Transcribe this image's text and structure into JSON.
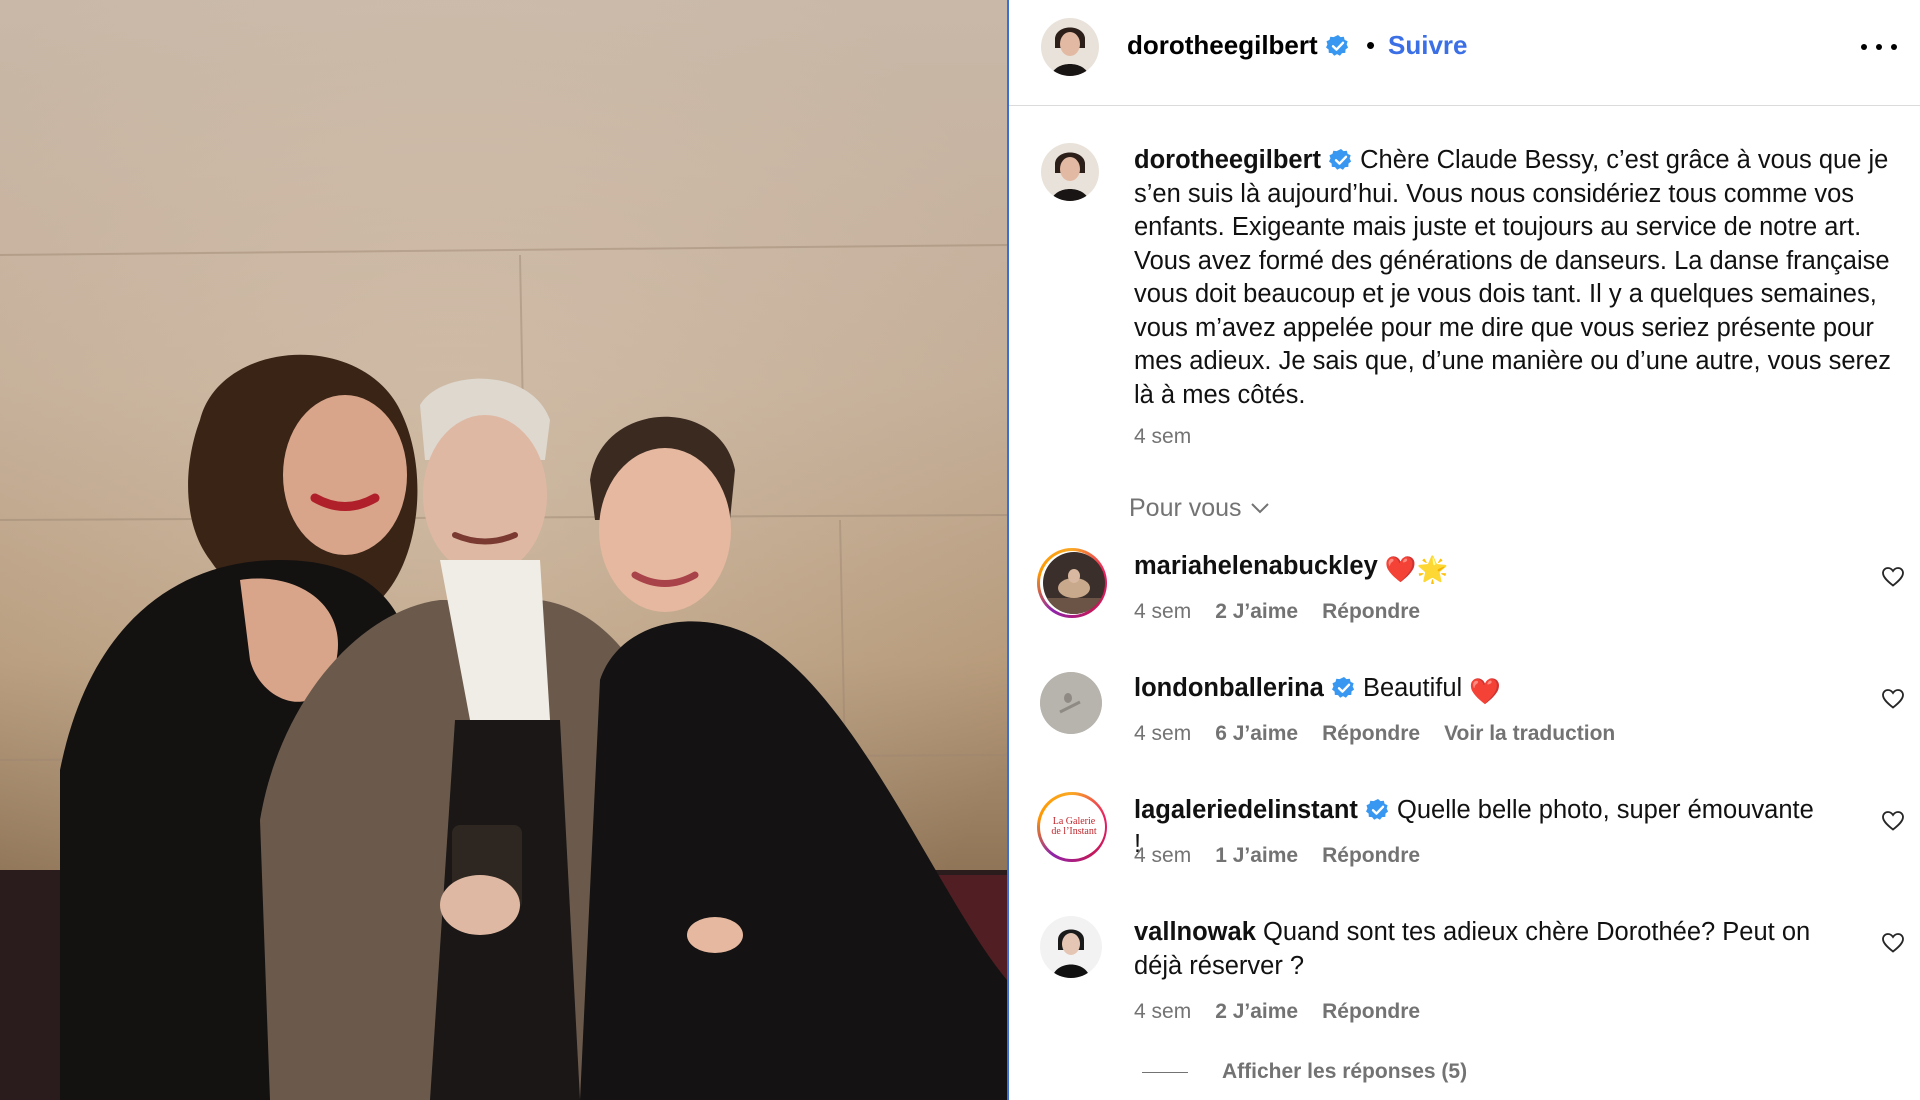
{
  "post": {
    "author": "dorotheegilbert",
    "follow_label": "Suivre",
    "header_separator": "•",
    "more_icon": "more-horizontal-icon",
    "photo_description_icon": "post-photo"
  },
  "caption": {
    "username": "dorotheegilbert",
    "text": "Chère Claude Bessy, c’est grâce à vous que je s’en suis là aujourd’hui. Vous nous considériez tous comme vos enfants. Exigeante mais juste et toujours au service de notre art. Vous avez formé des générations de danseurs. La danse française vous doit beaucoup et je vous dois tant. Il y a quelques semaines, vous m’avez appelée pour me dire que vous seriez présente pour mes adieux. Je sais que, d’une manière ou d’une autre, vous serez là à mes côtés.",
    "time": "4 sem"
  },
  "sort": {
    "label": "Pour vous"
  },
  "comments": [
    {
      "username": "mariahelenabuckley",
      "text": "",
      "emoji": "❤️🌟",
      "verified": false,
      "time": "4 sem",
      "likes": "2 J’aime",
      "reply": "Répondre",
      "translate": ""
    },
    {
      "username": "londonballerina",
      "text": "Beautiful",
      "emoji": "❤️",
      "verified": true,
      "time": "4 sem",
      "likes": "6 J’aime",
      "reply": "Répondre",
      "translate": "Voir la traduction"
    },
    {
      "username": "lagaleriedelinstant",
      "text": "Quelle belle photo, super émouvante !",
      "emoji": "",
      "verified": true,
      "time": "4 sem",
      "likes": "1 J’aime",
      "reply": "Répondre",
      "translate": "",
      "avatar_text": "La Galerie de l’Instant"
    },
    {
      "username": "vallnowak",
      "text": "Quand sont tes adieux chère Dorothée? Peut on déjà réserver ?",
      "emoji": "",
      "verified": false,
      "time": "4 sem",
      "likes": "2 J’aime",
      "reply": "Répondre",
      "translate": ""
    }
  ],
  "replies_label": "Afficher les réponses (5)",
  "colors": {
    "accent": "#3b6fe6",
    "verified": "#3897f0",
    "muted": "#737373",
    "heart": "#e0245e"
  }
}
